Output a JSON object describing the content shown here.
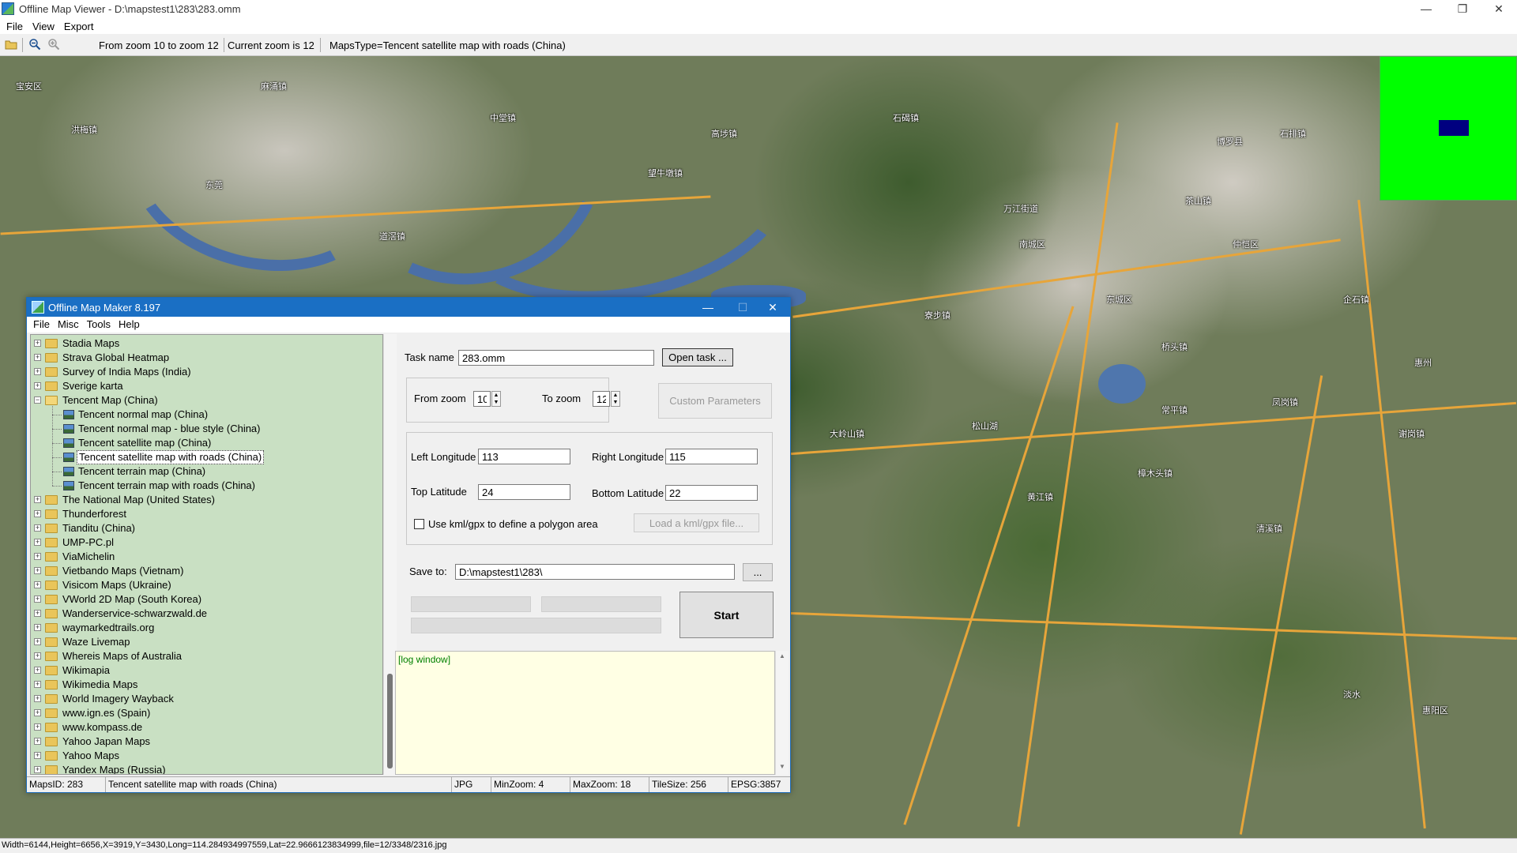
{
  "window": {
    "title": "Offline Map Viewer - D:\\mapstest1\\283\\283.omm",
    "menu": [
      "File",
      "View",
      "Export"
    ],
    "controls": [
      "—",
      "❐",
      "✕"
    ]
  },
  "toolbar": {
    "zoom_range": "From zoom 10 to zoom 12",
    "current_zoom": "Current zoom is 12",
    "maps_type": "MapsType=Tencent satellite map with roads (China)"
  },
  "map": {
    "labels": [
      "宝安区",
      "东莞",
      "洪梅镇",
      "麻涌镇",
      "道滘镇",
      "中堂镇",
      "望牛墩镇",
      "高埗镇",
      "石碣镇",
      "万江街道",
      "东城区",
      "南城区",
      "茶山镇",
      "石排镇",
      "企石镇",
      "寮步镇",
      "大岭山镇",
      "松山湖",
      "黄江镇",
      "樟木头镇",
      "凤岗镇",
      "清溪镇",
      "谢岗镇",
      "常平镇",
      "桥头镇",
      "惠阳区",
      "淡水",
      "惠州",
      "博罗县",
      "仲恺区"
    ]
  },
  "minimap": {
    "color": "#00ff00",
    "view_color": "#000080"
  },
  "statusbar": "Width=6144,Height=6656,X=3919,Y=3430,Long=114.284934997559,Lat=22.9666123834999,file=12/3348/2316.jpg",
  "dialog": {
    "title": "Offline Map Maker 8.197",
    "menu": [
      "File",
      "Misc",
      "Tools",
      "Help"
    ],
    "tree": [
      {
        "label": "Stadia Maps",
        "level": 0,
        "type": "folder"
      },
      {
        "label": "Strava Global Heatmap",
        "level": 0,
        "type": "folder"
      },
      {
        "label": "Survey of India Maps (India)",
        "level": 0,
        "type": "folder"
      },
      {
        "label": "Sverige karta",
        "level": 0,
        "type": "folder"
      },
      {
        "label": "Tencent Map (China)",
        "level": 0,
        "type": "folder",
        "open": true
      },
      {
        "label": "Tencent normal map (China)",
        "level": 1,
        "type": "map"
      },
      {
        "label": "Tencent normal map - blue style (China)",
        "level": 1,
        "type": "map"
      },
      {
        "label": "Tencent satellite map (China)",
        "level": 1,
        "type": "map"
      },
      {
        "label": "Tencent satellite map with roads (China)",
        "level": 1,
        "type": "map",
        "selected": true
      },
      {
        "label": "Tencent terrain map (China)",
        "level": 1,
        "type": "map"
      },
      {
        "label": "Tencent terrain map with roads (China)",
        "level": 1,
        "type": "map"
      },
      {
        "label": "The National Map (United States)",
        "level": 0,
        "type": "folder"
      },
      {
        "label": "Thunderforest",
        "level": 0,
        "type": "folder"
      },
      {
        "label": "Tianditu (China)",
        "level": 0,
        "type": "folder"
      },
      {
        "label": "UMP-PC.pl",
        "level": 0,
        "type": "folder"
      },
      {
        "label": "ViaMichelin",
        "level": 0,
        "type": "folder"
      },
      {
        "label": "Vietbando Maps (Vietnam)",
        "level": 0,
        "type": "folder"
      },
      {
        "label": "Visicom Maps (Ukraine)",
        "level": 0,
        "type": "folder"
      },
      {
        "label": "VWorld 2D Map (South Korea)",
        "level": 0,
        "type": "folder"
      },
      {
        "label": "Wanderservice-schwarzwald.de",
        "level": 0,
        "type": "folder"
      },
      {
        "label": "waymarkedtrails.org",
        "level": 0,
        "type": "folder"
      },
      {
        "label": "Waze Livemap",
        "level": 0,
        "type": "folder"
      },
      {
        "label": "Whereis Maps of Australia",
        "level": 0,
        "type": "folder"
      },
      {
        "label": "Wikimapia",
        "level": 0,
        "type": "folder"
      },
      {
        "label": "Wikimedia Maps",
        "level": 0,
        "type": "folder"
      },
      {
        "label": "World Imagery Wayback",
        "level": 0,
        "type": "folder"
      },
      {
        "label": "www.ign.es (Spain)",
        "level": 0,
        "type": "folder"
      },
      {
        "label": "www.kompass.de",
        "level": 0,
        "type": "folder"
      },
      {
        "label": "Yahoo Japan Maps",
        "level": 0,
        "type": "folder"
      },
      {
        "label": "Yahoo Maps",
        "level": 0,
        "type": "folder"
      },
      {
        "label": "Yandex Maps (Russia)",
        "level": 0,
        "type": "folder"
      }
    ],
    "task_name_label": "Task name",
    "task_name": "283.omm",
    "open_task": "Open task ...",
    "from_zoom_label": "From zoom",
    "from_zoom": "10",
    "to_zoom_label": "To zoom",
    "to_zoom": "12",
    "custom_params": "Custom Parameters",
    "left_lon_label": "Left Longitude",
    "left_lon": "113",
    "right_lon_label": "Right Longitude",
    "right_lon": "115",
    "top_lat_label": "Top Latitude",
    "top_lat": "24",
    "bottom_lat_label": "Bottom Latitude",
    "bottom_lat": "22",
    "kml_checkbox_label": "Use kml/gpx to define a polygon area",
    "load_kml": "Load a kml/gpx file...",
    "save_to_label": "Save to:",
    "save_to": "D:\\mapstest1\\283\\",
    "browse": "...",
    "start": "Start",
    "log_first_line": "[log window]",
    "status": {
      "maps_id": "MapsID: 283",
      "map_name": "Tencent satellite map with roads (China)",
      "format": "JPG",
      "min_zoom": "MinZoom: 4",
      "max_zoom": "MaxZoom: 18",
      "tile_size": "TileSize: 256",
      "epsg": "EPSG:3857"
    }
  }
}
